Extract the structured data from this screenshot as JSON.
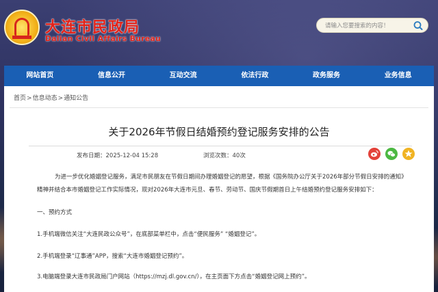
{
  "header": {
    "title": "大连市民政局",
    "subtitle": "Dalian Civil Affairs Bureau",
    "logo_icon": "civil-affairs-emblem",
    "search": {
      "placeholder": "请输入您要搜索的内容！",
      "icon": "search-icon"
    }
  },
  "nav": {
    "items": [
      {
        "label": "网站首页"
      },
      {
        "label": "信息公开"
      },
      {
        "label": "互动交流"
      },
      {
        "label": "依法行政"
      },
      {
        "label": "政务服务"
      },
      {
        "label": "业务信息"
      }
    ]
  },
  "breadcrumb": {
    "items": [
      "首页",
      "信息动态",
      "通知公告"
    ],
    "separator": ">"
  },
  "article": {
    "title": "关于2026年节假日结婚预约登记服务安排的公告",
    "date_label": "发布日期：",
    "date": "2025-12-04  15:28",
    "views_label": "浏览次数：",
    "views": "40次",
    "share_icons": [
      "weibo-icon",
      "wechat-icon",
      "favorite-icon"
    ],
    "paragraphs": [
      "为进一步优化婚姻登记服务，满足市民朋友在节假日期间办理婚姻登记的愿望，根据《国务院办公厅关于2026年部分节假日安排的通知》精神并结合本市婚姻登记工作实际情况，现对2026年大连市元旦、春节、劳动节、国庆节假期首日上午结婚预约登记服务安排如下：",
      "一、预约方式",
      "1.手机端微信关注“大连民政公众号”，在底部菜单栏中，点击“便民服务” “婚姻登记”。",
      "2.手机端登录“辽事通”APP，搜索“大连市婚姻登记预约”。",
      "3.电脑端登录大连市民政局门户网站（https://mzj.dl.gov.cn/），在主页面下方点击“婚姻登记网上预约”。"
    ]
  },
  "colors": {
    "nav_bg": "#1a5fb4",
    "title_red": "#e2231a",
    "weibo": "#e3423a",
    "wechat": "#4cb842",
    "favorite": "#f0b323"
  }
}
